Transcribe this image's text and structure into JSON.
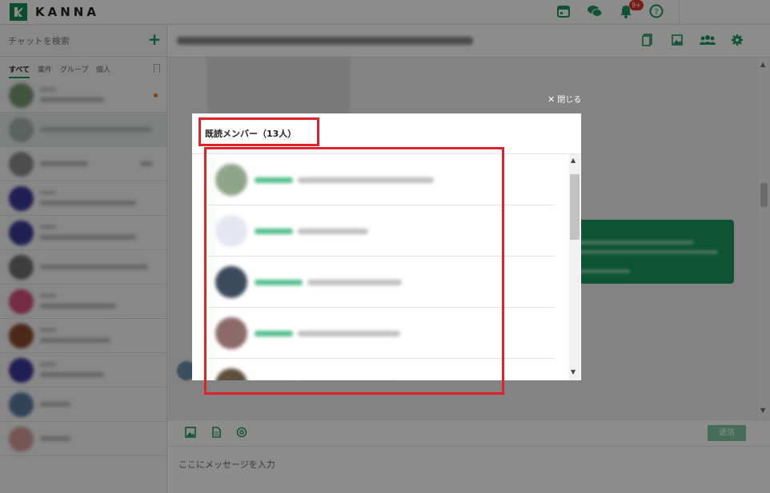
{
  "app": {
    "name": "KANNA"
  },
  "header": {
    "notification_count": "9+",
    "icons": [
      "calendar-icon",
      "chat-icon",
      "bell-icon",
      "help-icon"
    ]
  },
  "sidebar": {
    "search_placeholder": "チャットを検索",
    "add_label": "+",
    "tabs": [
      {
        "label": "すべて",
        "active": true
      },
      {
        "label": "案件"
      },
      {
        "label": "グループ"
      },
      {
        "label": "個人"
      }
    ]
  },
  "main": {
    "toolbar_icons": [
      "document-icon",
      "image-icon",
      "members-icon",
      "settings-icon"
    ],
    "composer": {
      "placeholder": "ここにメッセージを入力",
      "send_label": "送信",
      "icons": [
        "image-icon",
        "file-icon",
        "mention-icon"
      ]
    }
  },
  "modal": {
    "close_label": "閉じる",
    "title": "既読メンバー（13人）"
  },
  "colors": {
    "brand": "#1a9a5f",
    "annotation": "#e0232b",
    "badge": "#d9342b"
  }
}
